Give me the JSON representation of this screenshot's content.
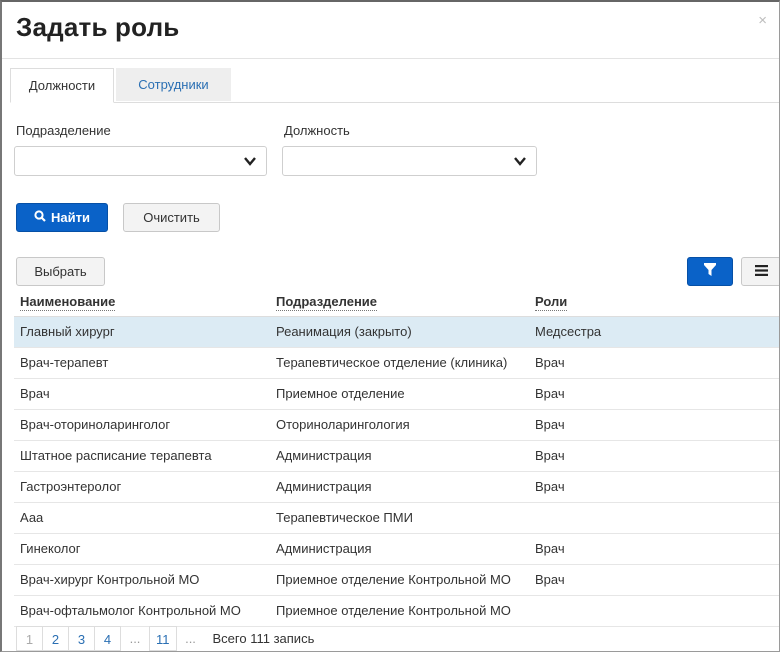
{
  "dialog": {
    "title": "Задать роль",
    "close": "×"
  },
  "tabs": [
    {
      "label": "Должности",
      "active": true
    },
    {
      "label": "Сотрудники",
      "active": false
    }
  ],
  "filters": {
    "department_label": "Подразделение",
    "department_value": "",
    "position_label": "Должность",
    "position_value": ""
  },
  "actions": {
    "find_label": "Найти",
    "clear_label": "Очистить",
    "select_label": "Выбрать"
  },
  "colors": {
    "primary": "#0a62c8",
    "selected_row": "#dcebf4",
    "link": "#2a6fb3"
  },
  "table": {
    "columns": [
      "Наименование",
      "Подразделение",
      "Роли"
    ],
    "rows": [
      [
        "Главный хирург",
        "Реанимация (закрыто)",
        "Медсестра"
      ],
      [
        "Врач-терапевт",
        "Терапевтическое отделение (клиника)",
        "Врач"
      ],
      [
        "Врач",
        "Приемное отделение",
        "Врач"
      ],
      [
        "Врач-оториноларинголог",
        "Оториноларингология",
        "Врач"
      ],
      [
        "Штатное расписание терапевта",
        "Администрация",
        "Врач"
      ],
      [
        "Гастроэнтеролог",
        "Администрация",
        "Врач"
      ],
      [
        "Ааа",
        "Терапевтическое ПМИ",
        ""
      ],
      [
        "Гинеколог",
        "Администрация",
        "Врач"
      ],
      [
        "Врач-хирург Контрольной МО",
        "Приемное отделение Контрольной МО",
        "Врач"
      ],
      [
        "Врач-офтальмолог Контрольной МО",
        "Приемное отделение Контрольной МО",
        ""
      ]
    ],
    "selected_row": 0
  },
  "pagination": {
    "pages": [
      "1",
      "2",
      "3",
      "4"
    ],
    "ellipsis": "...",
    "last": "11",
    "current": "1",
    "total_text": "Всего 111 запись"
  }
}
